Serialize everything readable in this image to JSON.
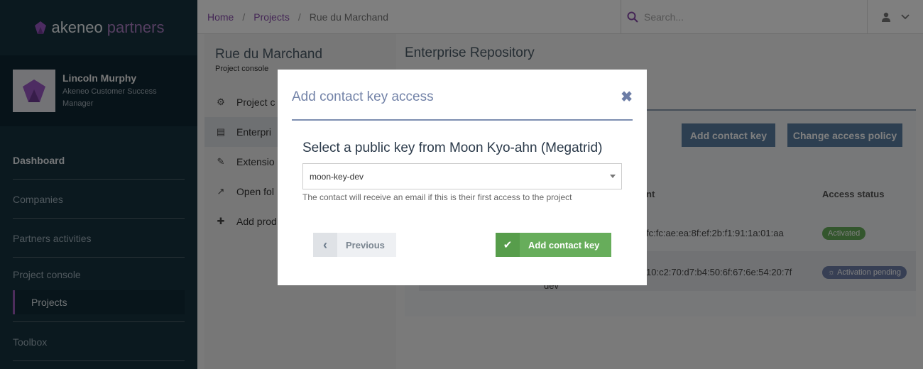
{
  "brand": {
    "name": "akeneo",
    "suffix": "partners"
  },
  "profile": {
    "name": "Lincoln Murphy",
    "role": "Akeneo Customer Success Manager"
  },
  "sidebar": {
    "items": [
      {
        "label": "Dashboard"
      },
      {
        "label": "Companies"
      },
      {
        "label": "Partners activities"
      },
      {
        "label": "Project console"
      },
      {
        "label": "Projects"
      },
      {
        "label": "Toolbox"
      }
    ]
  },
  "breadcrumb": {
    "home": "Home",
    "sep": "/",
    "projects": "Projects",
    "current": "Rue du Marchand"
  },
  "search": {
    "placeholder": "Search..."
  },
  "project": {
    "title": "Rue du Marchand",
    "subtitle": "Project console",
    "menu": [
      {
        "label": "Project c",
        "icon": "gears-icon"
      },
      {
        "label": "Enterpri",
        "icon": "file-icon"
      },
      {
        "label": "Extensio",
        "icon": "plug-icon"
      },
      {
        "label": "Open fol",
        "icon": "external-link-icon"
      },
      {
        "label": "Add prod",
        "icon": "plus-icon"
      }
    ]
  },
  "main": {
    "title": "Enterprise Repository",
    "add_contact_key": "Add contact key",
    "change_policy": "Change access policy",
    "columns": {
      "fingerprint": "nt",
      "status": "Access status"
    },
    "rows": [
      {
        "fingerprint": "fc:fc:ae:ea:8f:ef:2b:f1:91:1a:01:aa",
        "status": "Activated",
        "extra": ""
      },
      {
        "fingerprint": "10:c2:70:d7:b4:50:6f:67:6e:54:20:7f",
        "status": "Activation pending",
        "extra": "dev"
      }
    ]
  },
  "modal": {
    "title": "Add contact key access",
    "heading": "Select a public key from Moon Kyo-ahn (Megatrid)",
    "selected_key": "moon-key-dev",
    "help": "The contact will receive an email if this is their first access to the project",
    "previous": "Previous",
    "submit": "Add contact key"
  },
  "colors": {
    "accent": "#8a4fad",
    "sidebar": "#17323f",
    "primary_button": "#5a7fa3",
    "success": "#67ad5b",
    "pending": "#6e7fa8"
  }
}
